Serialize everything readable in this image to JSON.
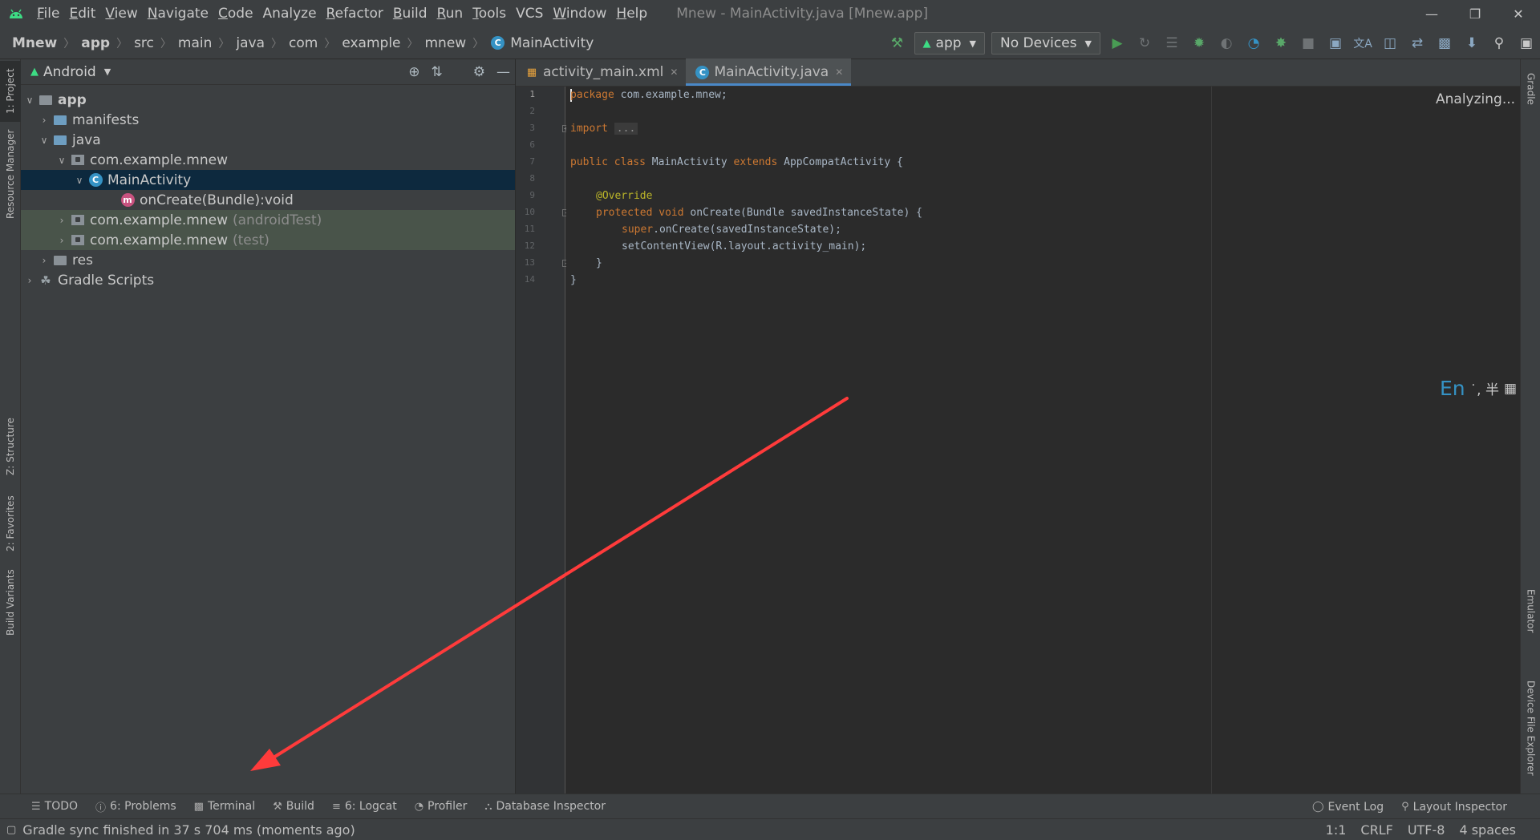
{
  "menubar": {
    "items": [
      {
        "label": "File",
        "u": "F",
        "rest": "ile"
      },
      {
        "label": "Edit",
        "u": "E",
        "rest": "dit"
      },
      {
        "label": "View",
        "u": "V",
        "rest": "iew"
      },
      {
        "label": "Navigate",
        "u": "N",
        "rest": "avigate"
      },
      {
        "label": "Code",
        "u": "C",
        "rest": "ode"
      },
      {
        "label": "Analyze",
        "u": "",
        "rest": "Analyze"
      },
      {
        "label": "Refactor",
        "u": "R",
        "rest": "efactor"
      },
      {
        "label": "Build",
        "u": "B",
        "rest": "uild"
      },
      {
        "label": "Run",
        "u": "R",
        "rest": "un"
      },
      {
        "label": "Tools",
        "u": "T",
        "rest": "ools"
      },
      {
        "label": "VCS",
        "u": "",
        "rest": "VCS"
      },
      {
        "label": "Window",
        "u": "W",
        "rest": "indow"
      },
      {
        "label": "Help",
        "u": "H",
        "rest": "elp"
      }
    ],
    "window_title": "Mnew - MainActivity.java [Mnew.app]"
  },
  "breadcrumb": [
    "Mnew",
    "app",
    "src",
    "main",
    "java",
    "com",
    "example",
    "mnew",
    "MainActivity"
  ],
  "toolbar": {
    "run_config": "app",
    "device": "No Devices"
  },
  "left_strip": {
    "project": "1: Project",
    "resource_manager": "Resource Manager",
    "structure": "Z: Structure",
    "favorites": "2: Favorites",
    "build_variants": "Build Variants"
  },
  "project_panel": {
    "view_mode": "Android",
    "tree": {
      "app": "app",
      "manifests": "manifests",
      "java": "java",
      "pkg_main": "com.example.mnew",
      "main_activity": "MainActivity",
      "on_create": "onCreate(Bundle):void",
      "pkg_android_test": "com.example.mnew",
      "pkg_android_test_suffix": "(androidTest)",
      "pkg_test": "com.example.mnew",
      "pkg_test_suffix": "(test)",
      "res": "res",
      "gradle_scripts": "Gradle Scripts"
    }
  },
  "editor": {
    "tabs": [
      {
        "label": "activity_main.xml"
      },
      {
        "label": "MainActivity.java"
      }
    ],
    "line_numbers": [
      "1",
      "2",
      "3",
      "6",
      "7",
      "8",
      "9",
      "10",
      "11",
      "12",
      "13",
      "14"
    ],
    "code": {
      "l1_kw": "package",
      "l1_rest": " com.example.mnew;",
      "l3_kw": "import",
      "l3_dots": "...",
      "l7_kw1": "public class",
      "l7_mid": " MainActivity ",
      "l7_kw2": "extends",
      "l7_rest": " AppCompatActivity {",
      "l9_ann": "@Override",
      "l10_kw": "protected void",
      "l10_rest": " onCreate(Bundle savedInstanceState) {",
      "l11_kw": "super",
      "l11_rest": ".onCreate(savedInstanceState);",
      "l12": "setContentView(R.layout.activity_main);",
      "l13": "}",
      "l14": "}"
    },
    "analyzing": "Analyzing...",
    "ime_en": "En",
    "ime_rest": "˙, 半"
  },
  "right_strip": {
    "gradle": "Gradle",
    "emulator": "Emulator",
    "device_file_explorer": "Device File Explorer"
  },
  "bottom_bar": {
    "todo": "TODO",
    "problems": "6: Problems",
    "terminal": "Terminal",
    "build": "Build",
    "logcat": "6: Logcat",
    "profiler": "Profiler",
    "database_inspector": "Database Inspector",
    "event_log": "Event Log",
    "layout_inspector": "Layout Inspector"
  },
  "status_bar": {
    "message": "Gradle sync finished in 37 s 704 ms (moments ago)",
    "position": "1:1",
    "line_sep": "CRLF",
    "encoding": "UTF-8",
    "indent": "4 spaces"
  },
  "colors": {
    "annotation_arrow": "#ff3b3b",
    "accent": "#4a88c7"
  }
}
